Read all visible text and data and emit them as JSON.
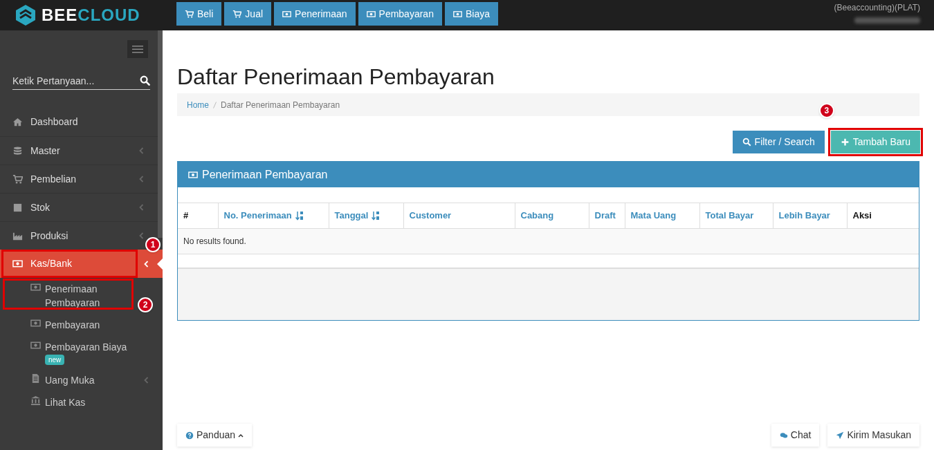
{
  "brand": {
    "name_a": "BEE",
    "name_b": "CLOUD"
  },
  "top_buttons": [
    {
      "label": "Beli"
    },
    {
      "label": "Jual"
    },
    {
      "label": "Penerimaan"
    },
    {
      "label": "Pembayaran"
    },
    {
      "label": "Biaya"
    }
  ],
  "account": {
    "company": "(Beeaccounting)(PLAT)"
  },
  "sidebar": {
    "search": {
      "placeholder": "Ketik Pertanyaan..."
    },
    "items": [
      {
        "label": "Dashboard",
        "has_caret": false,
        "selected": false
      },
      {
        "label": "Master",
        "has_caret": true,
        "selected": false
      },
      {
        "label": "Pembelian",
        "has_caret": true,
        "selected": false
      },
      {
        "label": "Stok",
        "has_caret": true,
        "selected": false
      },
      {
        "label": "Produksi",
        "has_caret": true,
        "selected": false
      },
      {
        "label": "Kas/Bank",
        "has_caret": true,
        "selected": true,
        "callout": "1",
        "children": [
          {
            "label": "Penerimaan Pembayaran",
            "has_caret": false,
            "callout": "2"
          },
          {
            "label": "Pembayaran",
            "has_caret": false
          },
          {
            "label": "Pembayaran Biaya",
            "has_caret": false,
            "badge": "new"
          },
          {
            "label": "Uang Muka",
            "has_caret": true
          },
          {
            "label": "Lihat Kas",
            "has_caret": false
          }
        ]
      }
    ]
  },
  "page_title": "Daftar Penerimaan Pembayaran",
  "breadcrumb": [
    "Home",
    "Daftar Penerimaan Pembayaran"
  ],
  "actions": [
    {
      "label": "Filter / Search",
      "kind": "filter"
    },
    {
      "label": "Tambah Baru",
      "kind": "add",
      "callout": "3"
    }
  ],
  "panel": {
    "title": "Penerimaan Pembayaran",
    "table": {
      "columns": [
        {
          "label": "#",
          "link": false,
          "sortable": false
        },
        {
          "label": "No. Penerimaan",
          "link": true,
          "sortable": true
        },
        {
          "label": "Tanggal",
          "link": true,
          "sortable": true
        },
        {
          "label": "Customer",
          "link": true,
          "sortable": false
        },
        {
          "label": "Cabang",
          "link": true,
          "sortable": false
        },
        {
          "label": "Draft",
          "link": true,
          "sortable": false
        },
        {
          "label": "Mata Uang",
          "link": true,
          "sortable": false
        },
        {
          "label": "Total Bayar",
          "link": true,
          "sortable": false
        },
        {
          "label": "Lebih Bayar",
          "link": true,
          "sortable": false
        },
        {
          "label": "Aksi",
          "link": false,
          "sortable": false
        }
      ],
      "empty_message": "No results found."
    }
  },
  "footer": {
    "left": [
      {
        "label": "Panduan",
        "kind": "help"
      }
    ],
    "right": [
      {
        "label": "Chat",
        "kind": "chat"
      },
      {
        "label": "Kirim Masukan",
        "kind": "send"
      }
    ]
  }
}
